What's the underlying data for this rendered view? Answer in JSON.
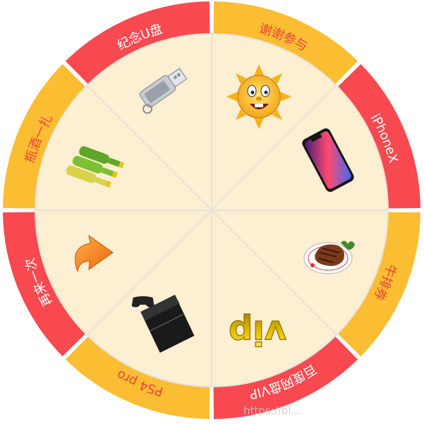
{
  "colors": {
    "inner": "#fdefd2",
    "outer_red": "#f7494f",
    "outer_yellow": "#fbbd32",
    "label_on_red": "#ffffff",
    "label_on_yellow": "#e9453c",
    "divider": "#e8e2d8"
  },
  "prizes": [
    {
      "label": "谢谢参与",
      "icon": "sun-face-icon",
      "outer": "outer_yellow"
    },
    {
      "label": "iPhoneX",
      "icon": "iphone-icon",
      "outer": "outer_red"
    },
    {
      "label": "牛排券",
      "icon": "steak-icon",
      "outer": "outer_yellow"
    },
    {
      "label": "百度网盘VIP",
      "icon": "vip-icon",
      "outer": "outer_red"
    },
    {
      "label": "PS4 pro",
      "icon": "ps4-icon",
      "outer": "outer_yellow"
    },
    {
      "label": "再来一次",
      "icon": "again-arrow-icon",
      "outer": "outer_red"
    },
    {
      "label": "瓶酒一扎",
      "icon": "beer-bottles-icon",
      "outer": "outer_yellow"
    },
    {
      "label": "纪念U盘",
      "icon": "usb-drive-icon",
      "outer": "outer_red"
    }
  ],
  "icon_texts": {
    "vip": "vip"
  },
  "watermark": "https://bl..."
}
